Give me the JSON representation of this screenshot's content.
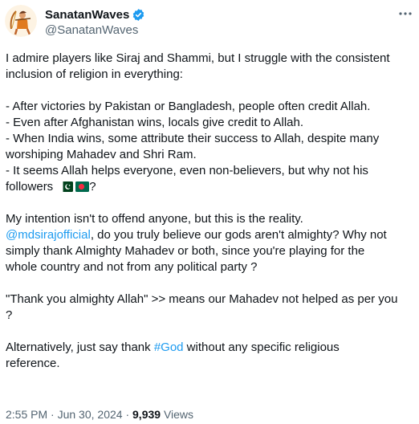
{
  "author": {
    "display_name": "SanatanWaves",
    "handle": "@SanatanWaves",
    "verified": true,
    "avatar_icon": "archer-avatar-icon"
  },
  "tweet": {
    "lines": [
      "I admire players like Siraj and Shammi, but I struggle with the consistent",
      "inclusion of religion in everything:",
      "",
      "- After victories by Pakistan or Bangladesh, people often credit Allah.",
      "- Even after Afghanistan wins, locals give credit to Allah.",
      "- When India wins, some attribute their success to Allah, despite many",
      "worshiping Mahadev and  Shri Ram.",
      "- It seems Allah helps everyone, even non-believers, but why not his",
      "followers",
      "",
      "My intention isn't to offend anyone, but this is the reality.",
      "",
      "simply thank Almighty Mahadev or both, since you're playing for the",
      "whole country and not from any political party ?",
      "",
      "\"Thank you almighty Allah\" >> means our Mahadev not helped as per you",
      "?",
      "",
      "",
      "reference."
    ],
    "followers_suffix": "?",
    "mention": "@mdsirajofficial",
    "mention_rest": ", do you truly believe our gods aren't almighty? Why not",
    "alt_prefix": "Alternatively, just say thank ",
    "hashtag": "#God",
    "alt_suffix": " without any specific religious"
  },
  "footer": {
    "time": "2:55 PM",
    "separator1": " · ",
    "date": "Jun 30, 2024",
    "separator2": " · ",
    "views_count": "9,939",
    "views_label": " Views"
  },
  "colors": {
    "text": "#0f1419",
    "secondary": "#536471",
    "link": "#1d9bf0",
    "verified": "#1d9bf0"
  }
}
